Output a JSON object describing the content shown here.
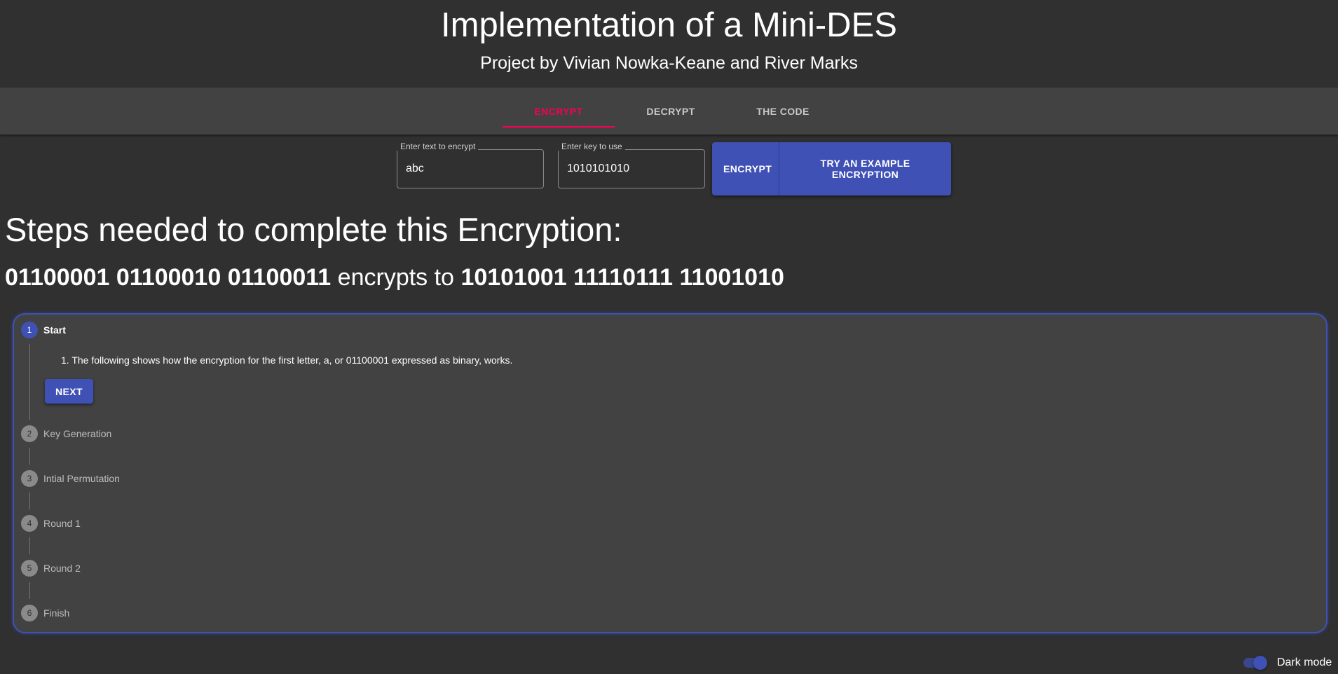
{
  "header": {
    "title": "Implementation of a Mini-DES",
    "subtitle": "Project by Vivian Nowka-Keane and River Marks"
  },
  "tabs": [
    {
      "label": "ENCRYPT",
      "active": true
    },
    {
      "label": "DECRYPT",
      "active": false
    },
    {
      "label": "THE CODE",
      "active": false
    }
  ],
  "form": {
    "text_field": {
      "label": "Enter text to encrypt",
      "value": "abc"
    },
    "key_field": {
      "label": "Enter key to use",
      "value": "1010101010"
    },
    "encrypt_label": "ENCRYPT",
    "example_label": "TRY AN EXAMPLE ENCRYPTION"
  },
  "steps_heading": "Steps needed to complete this Encryption:",
  "result": {
    "plaintext_bits": "01100001 01100010 01100011",
    "connector": "encrypts to",
    "ciphertext_bits": "10101001 11110111 11001010"
  },
  "stepper": {
    "steps": [
      {
        "number": "1",
        "label": "Start",
        "active": true
      },
      {
        "number": "2",
        "label": "Key Generation",
        "active": false
      },
      {
        "number": "3",
        "label": "Intial Permutation",
        "active": false
      },
      {
        "number": "4",
        "label": "Round 1",
        "active": false
      },
      {
        "number": "5",
        "label": "Round 2",
        "active": false
      },
      {
        "number": "6",
        "label": "Finish",
        "active": false
      }
    ],
    "active_content": "1. The following shows how the encryption for the first letter, a, or 01100001 expressed as binary, works.",
    "next_label": "NEXT"
  },
  "dark_mode": {
    "label": "Dark mode",
    "enabled": true
  },
  "colors": {
    "background": "#303030",
    "surface": "#424242",
    "primary": "#3f51b5",
    "accent": "#f50057"
  }
}
